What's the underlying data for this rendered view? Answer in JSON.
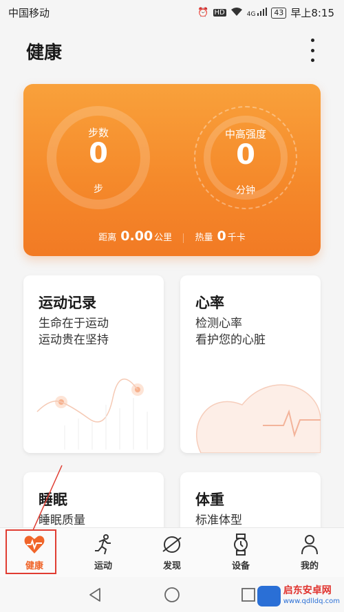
{
  "status_bar": {
    "carrier": "中国移动",
    "network": "4G",
    "battery": "43",
    "time": "早上8:15",
    "hd_label": "HD"
  },
  "app": {
    "title": "健康"
  },
  "summary": {
    "steps_label": "步数",
    "steps_value": "0",
    "steps_unit": "步",
    "intensity_label": "中高强度",
    "intensity_value": "0",
    "intensity_unit": "分钟",
    "distance_label": "距离",
    "distance_value": "0.00",
    "distance_unit": "公里",
    "calorie_label": "热量",
    "calorie_value": "0",
    "calorie_unit": "千卡"
  },
  "cards": {
    "exercise": {
      "title": "运动记录",
      "line1": "生命在于运动",
      "line2": "运动贵在坚持"
    },
    "heart": {
      "title": "心率",
      "line1": "检测心率",
      "line2": "看护您的心脏"
    },
    "sleep": {
      "title": "睡眠",
      "line1": "睡眠质量"
    },
    "weight": {
      "title": "体重",
      "line1": "标准体型"
    }
  },
  "tabs": [
    {
      "label": "健康",
      "icon": "heart-pulse-icon",
      "active": true
    },
    {
      "label": "运动",
      "icon": "runner-icon",
      "active": false
    },
    {
      "label": "发现",
      "icon": "planet-icon",
      "active": false
    },
    {
      "label": "设备",
      "icon": "watch-icon",
      "active": false
    },
    {
      "label": "我的",
      "icon": "person-icon",
      "active": false
    }
  ],
  "watermark": {
    "name": "启东安卓网",
    "url": "www.qdlldq.com"
  },
  "colors": {
    "accent": "#f0652a",
    "hero_top": "#f9a13b",
    "hero_bottom": "#f27a24",
    "highlight": "#e03c31"
  }
}
